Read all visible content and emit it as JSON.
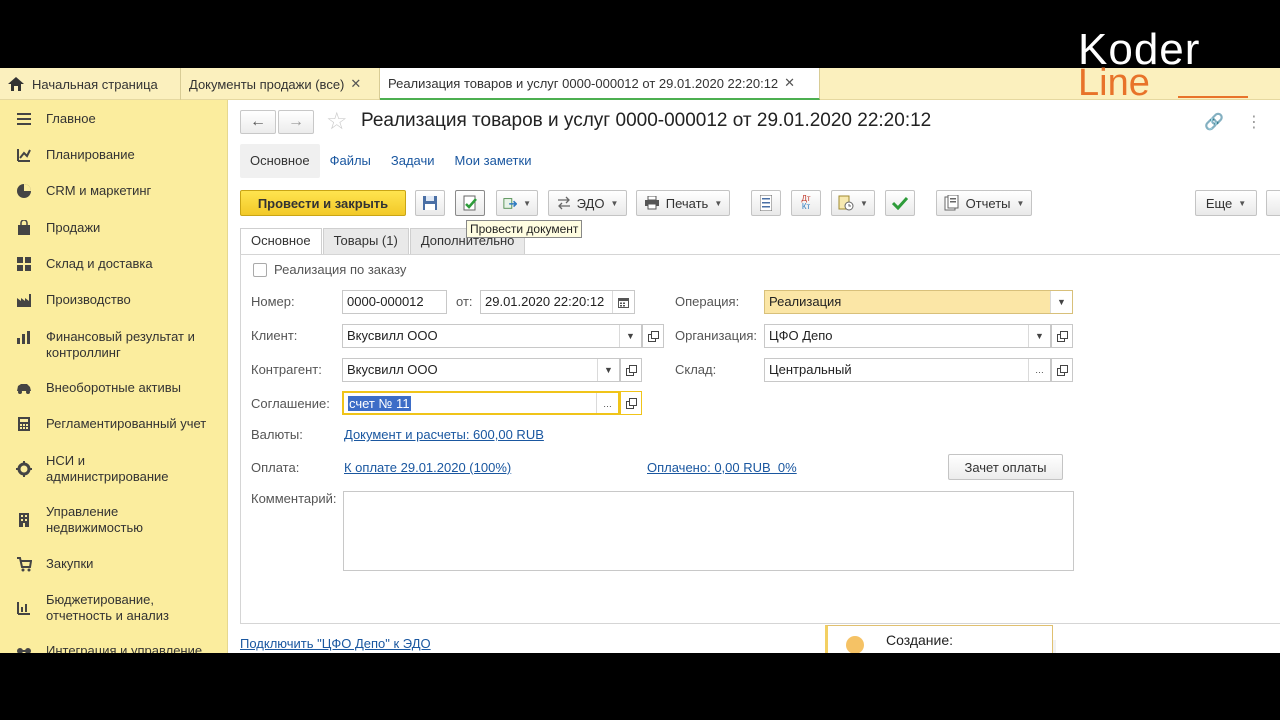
{
  "logo": {
    "line1": "Koder",
    "line2": "Line"
  },
  "tabs": [
    {
      "label": "Начальная страница"
    },
    {
      "label": "Документы продажи (все)"
    },
    {
      "label": "Реализация товаров и услуг 0000-000012 от 29.01.2020 22:20:12"
    }
  ],
  "sidebar": {
    "items": [
      {
        "label": "Главное",
        "icon": "menu-icon"
      },
      {
        "label": "Планирование",
        "icon": "planning-icon"
      },
      {
        "label": "CRM и маркетинг",
        "icon": "pie-chart-icon"
      },
      {
        "label": "Продажи",
        "icon": "bag-icon"
      },
      {
        "label": "Склад и доставка",
        "icon": "grid-icon"
      },
      {
        "label": "Производство",
        "icon": "factory-icon"
      },
      {
        "label": "Финансовый результат и контроллинг",
        "icon": "bar-chart-icon"
      },
      {
        "label": "Внеоборотные активы",
        "icon": "car-icon"
      },
      {
        "label": "Регламентированный учет",
        "icon": "calculator-icon"
      },
      {
        "label": "НСИ и администрирование",
        "icon": "gear-icon"
      },
      {
        "label": "Управление недвижимостью",
        "icon": "building-icon"
      },
      {
        "label": "Закупки",
        "icon": "cart-icon"
      },
      {
        "label": "Бюджетирование, отчетность и анализ",
        "icon": "report-icon"
      },
      {
        "label": "Интеграция и управление",
        "icon": "integration-icon"
      }
    ]
  },
  "header": {
    "title": "Реализация товаров и услуг 0000-000012 от 29.01.2020 22:20:12",
    "nav_back": "←",
    "nav_forward": "→",
    "star": "☆"
  },
  "subtabs": [
    "Основное",
    "Файлы",
    "Задачи",
    "Мои заметки"
  ],
  "toolbar": {
    "post_close": "Провести и закрыть",
    "edo": "ЭДО",
    "print": "Печать",
    "reports": "Отчеты",
    "more": "Еще",
    "dt_kt_top": "Дт",
    "dt_kt_bottom": "Кт",
    "tooltip": "Провести документ"
  },
  "form_tabs": [
    "Основное",
    "Товары (1)",
    "Дополнительно"
  ],
  "form": {
    "by_order_label": "Реализация по заказу",
    "number_label": "Номер:",
    "number_value": "0000-000012",
    "from_label": "от:",
    "date_value": "29.01.2020 22:20:12",
    "operation_label": "Операция:",
    "operation_value": "Реализация",
    "client_label": "Клиент:",
    "client_value": "Вкусвилл ООО",
    "org_label": "Организация:",
    "org_value": "ЦФО Депо",
    "counterparty_label": "Контрагент:",
    "counterparty_value": "Вкусвилл ООО",
    "warehouse_label": "Склад:",
    "warehouse_value": "Центральный",
    "agreement_label": "Соглашение:",
    "agreement_value": "счет № 11",
    "currency_label": "Валюты:",
    "currency_link": "Документ и расчеты: 600,00 RUB",
    "payment_label": "Оплата:",
    "payment_link": "К оплате 29.01.2020 (100%)",
    "paid_link": "Оплачено: 0,00 RUB  0%",
    "offset_button": "Зачет оплаты",
    "comment_label": "Комментарий:",
    "comment_value": ""
  },
  "footer": {
    "edo_link": "Подключить \"ЦФО Депо\" к ЭДО",
    "notification": "Создание:"
  }
}
